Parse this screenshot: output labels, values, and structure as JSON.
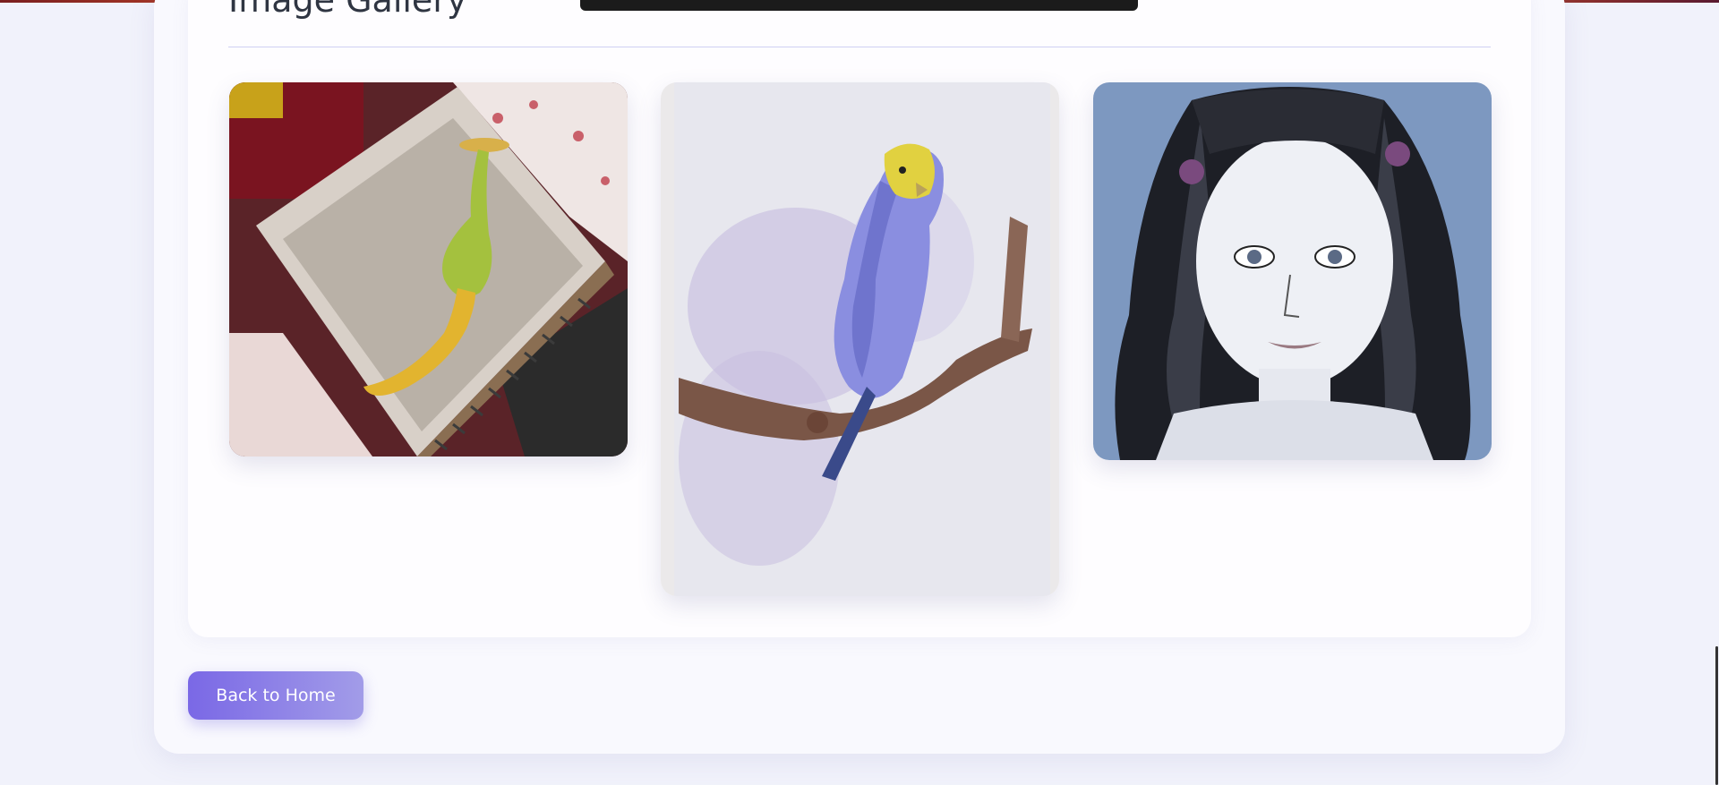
{
  "gallery": {
    "title": "Image Gallery",
    "images": [
      {
        "subject": "pencil drawing of a green and yellow vase in a sketchbook"
      },
      {
        "subject": "watercolor budgie perched on a branch"
      },
      {
        "subject": "ink portrait of a girl with long wavy hair"
      }
    ]
  },
  "actions": {
    "back_label": "Back to Home"
  },
  "colors": {
    "page_background": "#f1f2fb",
    "card_background": "#fefdff",
    "button_gradient_start": "#7a68e6",
    "button_gradient_end": "#a29ce8",
    "title_color": "#2f3542",
    "divider_color": "#cfd0f3"
  }
}
